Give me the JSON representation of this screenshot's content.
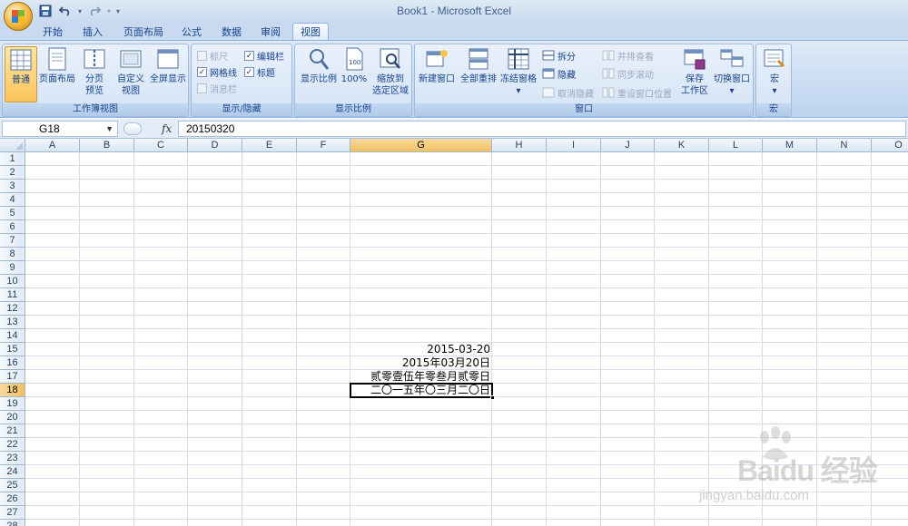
{
  "window": {
    "title": "Book1 - Microsoft Excel"
  },
  "quick_access": {
    "save_icon": "save-icon",
    "undo_icon": "undo-icon",
    "redo_icon": "redo-icon",
    "customize_icon": "customize-qat-icon"
  },
  "tabs": [
    {
      "label": "开始"
    },
    {
      "label": "插入"
    },
    {
      "label": "页面布局"
    },
    {
      "label": "公式"
    },
    {
      "label": "数据"
    },
    {
      "label": "审阅"
    },
    {
      "label": "视图",
      "active": true
    }
  ],
  "ribbon": {
    "workbook_views": {
      "label": "工作簿视图",
      "normal": "普通",
      "page_layout": "页面布局",
      "page_break_1": "分页",
      "page_break_2": "预览",
      "custom_1": "自定义",
      "custom_2": "视图",
      "fullscreen": "全屏显示"
    },
    "show_hide": {
      "label": "显示/隐藏",
      "ruler": "标尺",
      "gridlines": "网格线",
      "message_bar": "消息栏",
      "formula_bar": "编辑栏",
      "headings": "标题",
      "check_mark": "✓"
    },
    "zoom": {
      "label": "显示比例",
      "zoom": "显示比例",
      "hundred": "100%",
      "zoom_sel_1": "缩放到",
      "zoom_sel_2": "选定区域"
    },
    "window": {
      "label": "窗口",
      "new_window": "新建窗口",
      "arrange_all": "全部重排",
      "freeze_panes": "冻结窗格",
      "dropdown_arrow": "▾",
      "split": "拆分",
      "hide": "隐藏",
      "unhide": "取消隐藏",
      "side_by_side": "并排查看",
      "sync_scroll": "同步滚动",
      "reset_position": "重设窗口位置",
      "save_workspace_1": "保存",
      "save_workspace_2": "工作区",
      "switch_windows": "切换窗口"
    },
    "macros": {
      "label": "宏",
      "macros": "宏"
    }
  },
  "formula_bar": {
    "name_box": "G18",
    "name_box_arrow": "▼",
    "fx": "fx",
    "formula": "20150320"
  },
  "columns": [
    "A",
    "B",
    "C",
    "D",
    "E",
    "F",
    "G",
    "H",
    "I",
    "J",
    "K",
    "L",
    "M",
    "N",
    "O"
  ],
  "selected_column": "G",
  "rows": [
    "1",
    "2",
    "3",
    "4",
    "5",
    "6",
    "7",
    "8",
    "9",
    "10",
    "11",
    "12",
    "13",
    "14",
    "15",
    "16",
    "17",
    "18",
    "19",
    "20",
    "21",
    "22",
    "23",
    "24",
    "25",
    "26",
    "27",
    "28"
  ],
  "selected_row": "18",
  "cells": {
    "G15": "2015-03-20",
    "G16": "2015年03月20日",
    "G17": "贰零壹伍年零叁月贰零日",
    "G18": "二〇一五年〇三月二〇日"
  },
  "watermark": {
    "brand": "Baidu 经验",
    "url": "jingyan.baidu.com"
  }
}
